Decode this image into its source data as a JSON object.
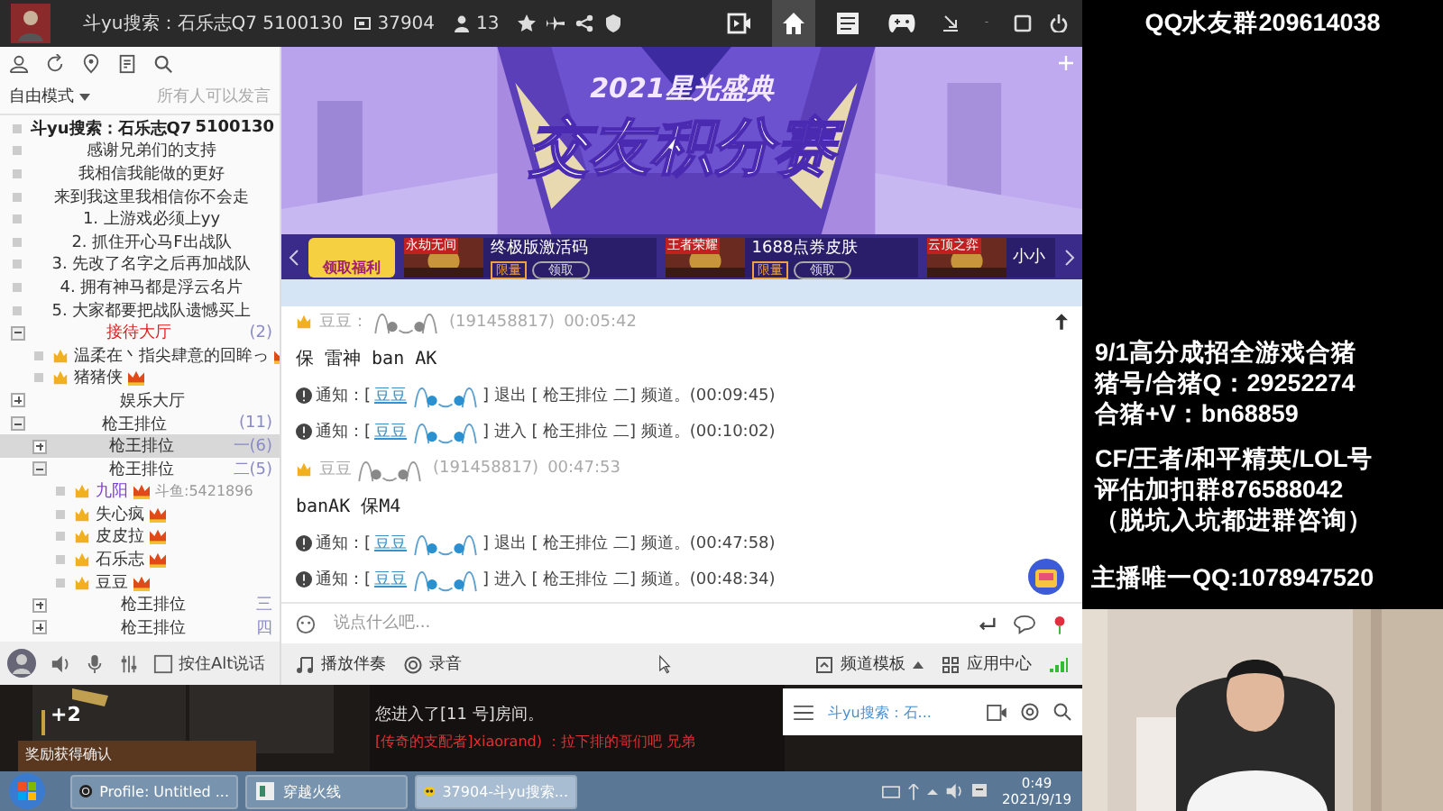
{
  "title_bar": {
    "title": "斗yu搜索：石乐志Q7 5100130",
    "viewers": "37904",
    "members": "13",
    "nav": [
      {
        "kind": "video",
        "selected": false
      },
      {
        "kind": "home",
        "selected": true
      },
      {
        "kind": "list",
        "selected": false
      },
      {
        "kind": "game",
        "selected": false
      }
    ]
  },
  "left_panel": {
    "mode": "自由模式",
    "mode_hint": "所有人可以发言",
    "channels": [
      {
        "kind": "notice",
        "name": "斗yu搜索：石乐志Q7",
        "count": "5100130",
        "selected": false
      },
      {
        "kind": "notice",
        "name": "感谢兄弟们的支持",
        "selected": false
      },
      {
        "kind": "notice",
        "name": "我相信我能做的更好",
        "selected": false
      },
      {
        "kind": "notice",
        "name": "来到我这里我相信你不会走",
        "selected": false
      },
      {
        "kind": "notice",
        "name": "1. 上游戏必须上yy",
        "selected": false
      },
      {
        "kind": "notice",
        "name": "2. 抓住开心马F出战队",
        "selected": false
      },
      {
        "kind": "notice",
        "name": "3. 先改了名字之后再加战队",
        "selected": false
      },
      {
        "kind": "notice",
        "name": "4. 拥有神马都是浮云名片",
        "selected": false
      },
      {
        "kind": "notice",
        "name": "5. 大家都要把战队遗憾买上",
        "selected": false
      },
      {
        "kind": "channel",
        "name": "接待大厅",
        "count": "(2)",
        "expanded": true,
        "selected": false,
        "color": "#e02020",
        "children": [
          {
            "kind": "user",
            "name": "温柔在丶指尖肆意的回眸っ",
            "selected": false,
            "color": "#333333"
          },
          {
            "kind": "user",
            "name": "猪猪侠",
            "selected": false,
            "color": "#333333"
          }
        ]
      },
      {
        "kind": "channel",
        "name": "娱乐大厅",
        "expanded": false,
        "selected": false,
        "color": "#333333"
      },
      {
        "kind": "channel",
        "name": "枪王排位",
        "count": "(11)",
        "expanded": true,
        "selected": false,
        "color": "#333333",
        "children": [
          {
            "kind": "channel",
            "name": "枪王排位",
            "count": "一(6)",
            "expanded": false,
            "selected": true,
            "color": "#333333"
          },
          {
            "kind": "channel",
            "name": "枪王排位",
            "count": "二(5)",
            "expanded": true,
            "selected": false,
            "color": "#333333",
            "children": [
              {
                "kind": "user",
                "name": "九阳",
                "note": "斗鱼:5421896",
                "selected": false,
                "color": "#7a3fd0"
              },
              {
                "kind": "user",
                "name": "失心疯",
                "selected": false,
                "color": "#333333"
              },
              {
                "kind": "user",
                "name": "皮皮拉",
                "selected": false,
                "color": "#333333"
              },
              {
                "kind": "user",
                "name": "石乐志",
                "selected": false,
                "color": "#333333"
              },
              {
                "kind": "user",
                "name": "豆豆",
                "selected": false,
                "color": "#333333"
              }
            ]
          },
          {
            "kind": "channel",
            "name": "枪王排位",
            "count": "三",
            "expanded": false,
            "selected": false,
            "color": "#333333"
          },
          {
            "kind": "channel",
            "name": "枪王排位",
            "count": "四",
            "expanded": false,
            "selected": false,
            "color": "#333333"
          }
        ]
      }
    ],
    "talk_mode": "按住Alt说话"
  },
  "banner": {
    "subtitle": "2021星光盛典",
    "title": "交友积分赛",
    "cards": [
      {
        "kind": "promo",
        "title": "领取福利"
      },
      {
        "kind": "offer",
        "tag": "永劫无间",
        "title": "终极版激活码",
        "badge": "限量",
        "action": "领取"
      },
      {
        "kind": "offer",
        "tag": "王者荣耀",
        "title": "1688点券皮肤",
        "badge": "限量",
        "action": "领取"
      },
      {
        "kind": "offer",
        "tag": "云顶之弈",
        "title": "小小"
      }
    ]
  },
  "chat": [
    {
      "kind": "header",
      "user": "豆豆：",
      "id": "(191458817)",
      "time": "00:05:42"
    },
    {
      "kind": "text",
      "text": "保 雷神  ban AK"
    },
    {
      "kind": "notice",
      "prefix": "通知：[",
      "user": "豆豆",
      "text": "] 退出 [      枪王排位    二] 频道。(00:09:45)"
    },
    {
      "kind": "notice",
      "prefix": "通知：[",
      "user": "豆豆",
      "text": "] 进入 [      枪王排位    二] 频道。(00:10:02)"
    },
    {
      "kind": "header",
      "user": "豆豆",
      "id": "(191458817)",
      "time": "00:47:53"
    },
    {
      "kind": "text",
      "text": "banAK  保M4"
    },
    {
      "kind": "notice",
      "prefix": "通知：[",
      "user": "豆豆",
      "text": "] 退出 [      枪王排位    二] 频道。(00:47:58)"
    },
    {
      "kind": "notice",
      "prefix": "通知：[",
      "user": "豆豆",
      "text": "] 进入 [      枪王排位    二] 频道。(00:48:34)"
    }
  ],
  "input": {
    "placeholder": "说点什么吧..."
  },
  "toolbar": {
    "music": "播放伴奏",
    "record": "录音",
    "template": "频道模板",
    "apps": "应用中心"
  },
  "game": {
    "count": "+2",
    "reward": "奖励获得确认",
    "room": "您进入了[11 号]房间。",
    "shout": "[传奇的支配者]xiaorand) ：拉下排的哥们吧 兄弟",
    "mini_title": "斗yu搜索：石..."
  },
  "taskbar": {
    "tasks": [
      {
        "kind": "obs",
        "label": "Profile: Untitled ...",
        "selected": false
      },
      {
        "kind": "game",
        "label": "穿越火线",
        "selected": false
      },
      {
        "kind": "yy",
        "label": "37904-斗yu搜索...",
        "selected": true
      }
    ],
    "time": "0:49",
    "date": "2021/9/19"
  },
  "overlay": {
    "group": "QQ水友群209614038",
    "ad": [
      "9/1高分成招全游戏合猪",
      "猪号/合猪Q：29252274",
      "合猪+V：bn68859"
    ],
    "service": [
      "CF/王者/和平精英/LOL号",
      "评估加扣群876588042",
      "（脱坑入坑都进群咨询）"
    ],
    "contact": "主播唯一QQ:1078947520"
  }
}
